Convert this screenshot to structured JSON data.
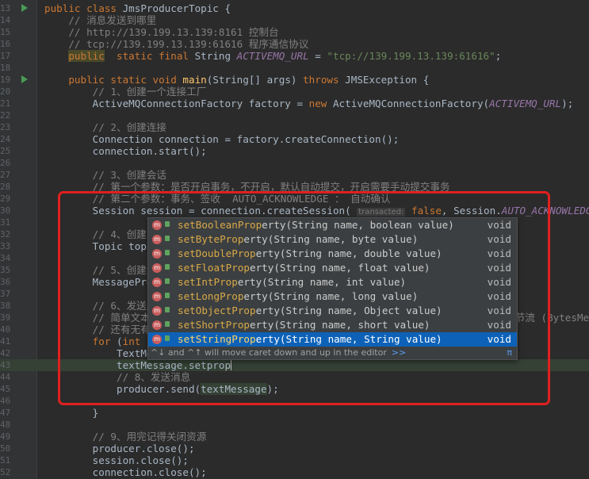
{
  "editor": {
    "lines": [
      {
        "n": "13",
        "run": true,
        "seg": [
          [
            "k",
            "public class "
          ],
          [
            "",
            "JmsProducerTopic {"
          ]
        ]
      },
      {
        "n": "14",
        "seg": [
          [
            "c",
            "    // 消息发送到哪里"
          ]
        ]
      },
      {
        "n": "15",
        "seg": [
          [
            "c",
            "    // http://139.199.13.139:8161 控制台"
          ]
        ]
      },
      {
        "n": "16",
        "seg": [
          [
            "c",
            "    // tcp://139.199.13.139:61616 程序通信协议"
          ]
        ]
      },
      {
        "n": "17",
        "seg": [
          [
            "",
            "    "
          ],
          [
            "bl",
            "public"
          ],
          [
            "",
            "  "
          ],
          [
            "k",
            "static final "
          ],
          [
            "",
            "String "
          ],
          [
            "f",
            "ACTIVEMQ_URL"
          ],
          [
            "",
            " = "
          ],
          [
            "s",
            "\"tcp://139.199.13.139:61616\""
          ],
          [
            "",
            ";"
          ]
        ]
      },
      {
        "n": "18",
        "seg": []
      },
      {
        "n": "19",
        "run": true,
        "seg": [
          [
            "",
            "    "
          ],
          [
            "k",
            "public static void "
          ],
          [
            "m",
            "main"
          ],
          [
            "",
            "(String[] args) "
          ],
          [
            "k",
            "throws "
          ],
          [
            "",
            "JMSException {"
          ]
        ]
      },
      {
        "n": "20",
        "seg": [
          [
            "c",
            "        // 1、创建一个连接工厂"
          ]
        ]
      },
      {
        "n": "21",
        "seg": [
          [
            "",
            "        ActiveMQConnectionFactory factory = "
          ],
          [
            "k",
            "new "
          ],
          [
            "",
            "ActiveMQConnectionFactory("
          ],
          [
            "f",
            "ACTIVEMQ_URL"
          ],
          [
            "",
            ");"
          ]
        ]
      },
      {
        "n": "22",
        "seg": []
      },
      {
        "n": "23",
        "seg": [
          [
            "c",
            "        // 2、创建连接"
          ]
        ]
      },
      {
        "n": "24",
        "seg": [
          [
            "",
            "        Connection connection = factory.createConnection();"
          ]
        ]
      },
      {
        "n": "25",
        "seg": [
          [
            "",
            "        connection.start();"
          ]
        ]
      },
      {
        "n": "26",
        "seg": []
      },
      {
        "n": "27",
        "seg": [
          [
            "c",
            "        // 3、创建会话"
          ]
        ]
      },
      {
        "n": "28",
        "seg": [
          [
            "c",
            "        // 第一个参数：是否开启事务，不开启，默认自动提交，开启需要手动提交事务"
          ]
        ]
      },
      {
        "n": "29",
        "seg": [
          [
            "c",
            "        // 第二个参数：事务、签收  AUTO_ACKNOWLEDGE ： 自动确认"
          ]
        ]
      },
      {
        "n": "30",
        "seg": [
          [
            "",
            "        Session session = connection.createSession( "
          ],
          [
            "hint",
            "transacted:"
          ],
          [
            "k",
            " false"
          ],
          [
            "",
            ", Session."
          ],
          [
            "f",
            "AUTO_ACKNOWLEDGE"
          ],
          [
            "",
            ");"
          ]
        ]
      },
      {
        "n": "31",
        "seg": []
      },
      {
        "n": "32",
        "seg": [
          [
            "c",
            "        // 4、创建目"
          ]
        ]
      },
      {
        "n": "33",
        "seg": [
          [
            "",
            "        Topic topic"
          ]
        ]
      },
      {
        "n": "34",
        "seg": []
      },
      {
        "n": "35",
        "seg": [
          [
            "c",
            "        // 5、创建消"
          ]
        ]
      },
      {
        "n": "36",
        "seg": [
          [
            "",
            "        MessageProd"
          ]
        ]
      },
      {
        "n": "37",
        "seg": []
      },
      {
        "n": "38",
        "seg": [
          [
            "c",
            "        // 6、发送具                                                        "
          ]
        ]
      },
      {
        "n": "39",
        "seg": [
          [
            "c",
            "        // 简单文本(                                                          字节流 (BytesMe"
          ]
        ]
      },
      {
        "n": "40",
        "seg": [
          [
            "c",
            "        // 还有无有效"
          ]
        ]
      },
      {
        "n": "41",
        "seg": [
          [
            "",
            "        "
          ],
          [
            "k",
            "for "
          ],
          [
            "",
            "("
          ],
          [
            "k",
            "int "
          ],
          [
            "",
            "i"
          ]
        ]
      },
      {
        "n": "42",
        "seg": [
          [
            "",
            "            TextMes"
          ]
        ]
      },
      {
        "n": "43",
        "hl": true,
        "caret": true,
        "seg": [
          [
            "",
            "            textMessage.setprop"
          ]
        ]
      },
      {
        "n": "44",
        "seg": [
          [
            "c",
            "            // 8、发送消息"
          ]
        ]
      },
      {
        "n": "45",
        "seg": [
          [
            "",
            "            producer.send("
          ],
          [
            "hlv",
            "textMessage"
          ],
          [
            "",
            ");"
          ]
        ]
      },
      {
        "n": "46",
        "seg": []
      },
      {
        "n": "47",
        "seg": [
          [
            "",
            "        }"
          ]
        ]
      },
      {
        "n": "48",
        "seg": []
      },
      {
        "n": "49",
        "seg": [
          [
            "c",
            "        // 9、用完记得关闭资源"
          ]
        ]
      },
      {
        "n": "50",
        "seg": [
          [
            "",
            "        producer.close();"
          ]
        ]
      },
      {
        "n": "51",
        "seg": [
          [
            "",
            "        session.close();"
          ]
        ]
      },
      {
        "n": "52",
        "seg": [
          [
            "",
            "        connection.close();"
          ]
        ]
      }
    ]
  },
  "completion": {
    "items": [
      {
        "match": "setBooleanProp",
        "rest": "erty",
        "params": "(String name, boolean value)",
        "type": "void"
      },
      {
        "match": "setByteProp",
        "rest": "erty",
        "params": "(String name, byte value)",
        "type": "void"
      },
      {
        "match": "setDoubleProp",
        "rest": "erty",
        "params": "(String name, double value)",
        "type": "void"
      },
      {
        "match": "setFloatProp",
        "rest": "erty",
        "params": "(String name, float value)",
        "type": "void"
      },
      {
        "match": "setIntProp",
        "rest": "erty",
        "params": "(String name, int value)",
        "type": "void"
      },
      {
        "match": "setLongProp",
        "rest": "erty",
        "params": "(String name, long value)",
        "type": "void"
      },
      {
        "match": "setObjectProp",
        "rest": "erty",
        "params": "(String name, Object value)",
        "type": "void"
      },
      {
        "match": "setShortProp",
        "rest": "erty",
        "params": "(String name, short value)",
        "type": "void"
      },
      {
        "match": "setStringProp",
        "rest": "erty",
        "params": "(String name, String value)",
        "type": "void",
        "selected": true
      }
    ],
    "icon_letter": "m",
    "footer_text": "^↓ and ^↑ will move caret down and up in the editor",
    "footer_link": ">>",
    "footer_pi": "π"
  },
  "colors": {
    "keyword": "#cc7832",
    "comment": "#808080",
    "string": "#6a8759",
    "field": "#9876aa",
    "selection": "#0d62b8",
    "annotation_box": "#e0201f"
  }
}
